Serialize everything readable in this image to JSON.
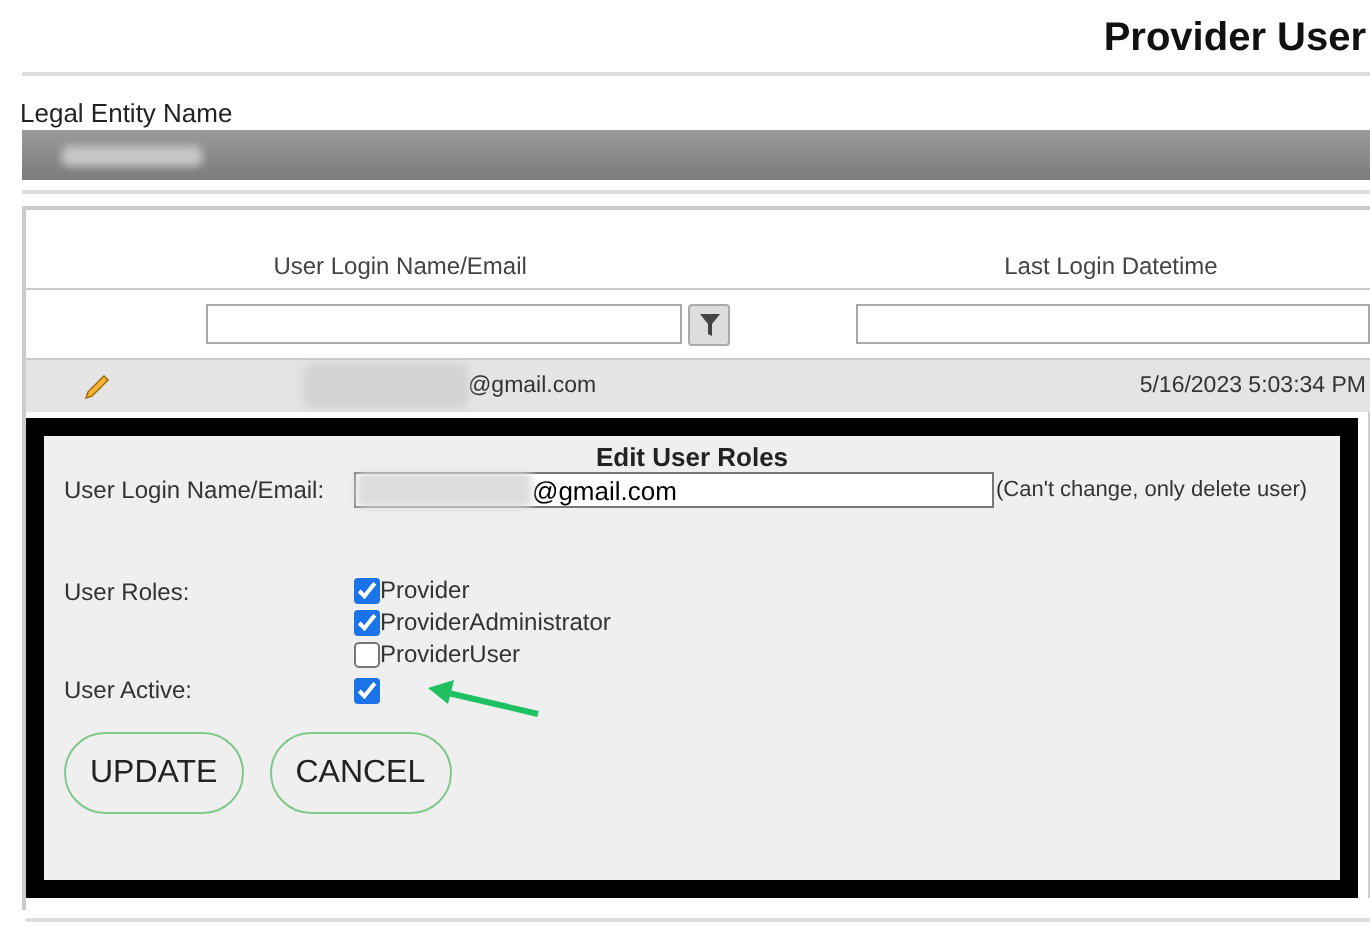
{
  "page": {
    "title": "Provider User"
  },
  "legal_entity": {
    "label": "Legal Entity Name"
  },
  "table": {
    "columns": [
      {
        "header": "User Login Name/Email"
      },
      {
        "header": "Last Login Datetime"
      }
    ],
    "rows": [
      {
        "email": "@gmail.com",
        "last_login": "5/16/2023 5:03:34 PM"
      }
    ]
  },
  "edit_panel": {
    "title": "Edit User Roles",
    "email_label": "User Login Name/Email:",
    "email_value": "@gmail.com",
    "email_note": "(Can't change, only delete user)",
    "roles_label": "User Roles:",
    "roles": [
      {
        "label": "Provider",
        "checked": true
      },
      {
        "label": "ProviderAdministrator",
        "checked": true
      },
      {
        "label": "ProviderUser",
        "checked": false
      }
    ],
    "active_label": "User Active:",
    "active": true,
    "buttons": [
      "UPDATE",
      "CANCEL"
    ]
  }
}
